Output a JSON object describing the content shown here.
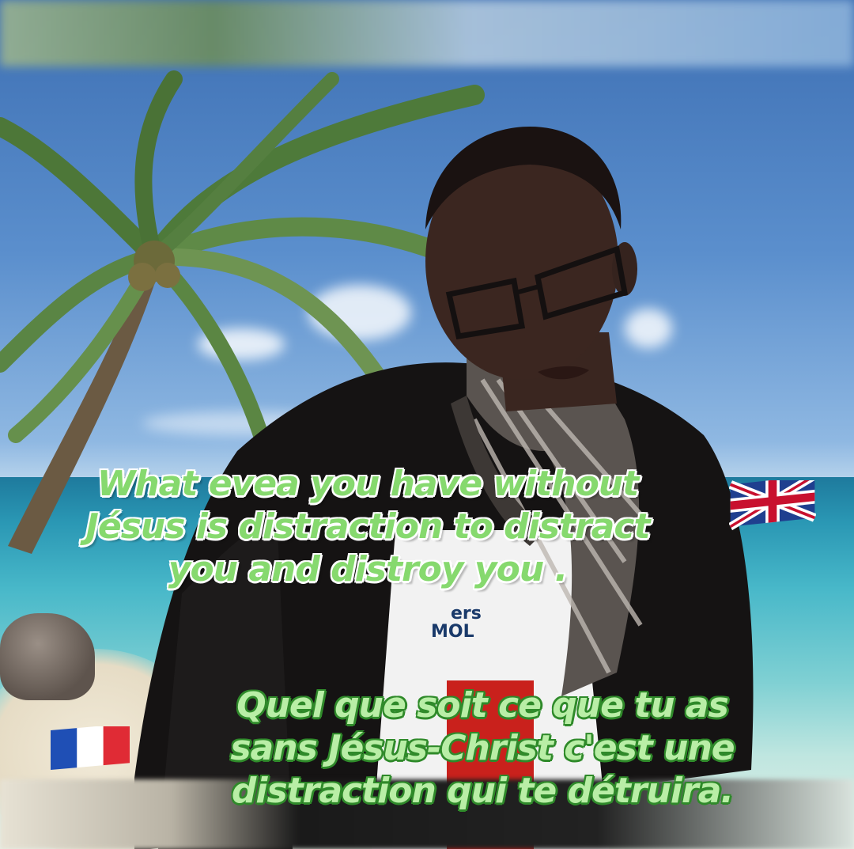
{
  "quote_en": {
    "lines": [
      "What evea you have without",
      "Jésus is distraction to distract",
      "you and distroy you ."
    ]
  },
  "quote_fr": {
    "lines": [
      "Quel que soit ce que tu as",
      "sans Jésus-Christ c'est une",
      "distraction qui te détruira."
    ]
  },
  "shirt_text": {
    "line1": "ers",
    "line2": "MOL"
  },
  "flags": {
    "english": "uk-flag-icon",
    "french": "france-flag-icon"
  },
  "colors": {
    "en_text": "#86d96e",
    "fr_text": "#b9eea6",
    "fr_outline": "#2f8a2a"
  }
}
